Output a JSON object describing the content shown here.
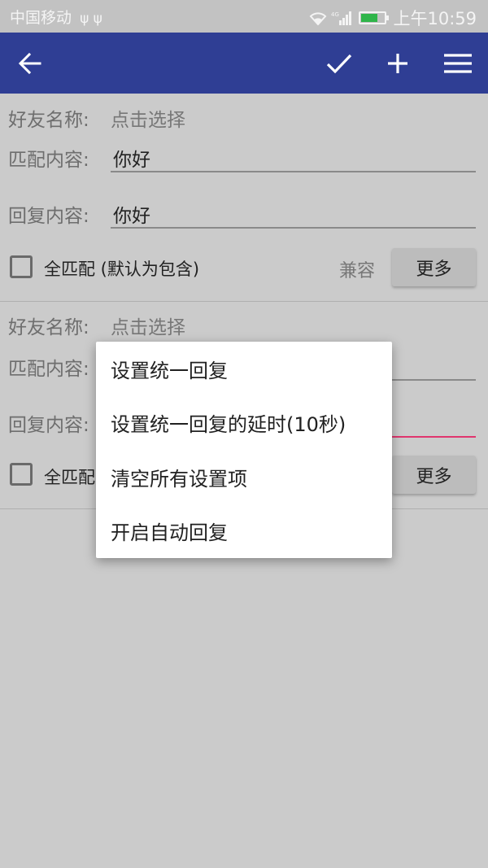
{
  "status_bar": {
    "carrier": "中国移动",
    "usb_glyphs": "ψ ψ",
    "network_type": "4G",
    "time": "上午10:59",
    "battery_level": 0.7
  },
  "toolbar": {
    "back_icon": "arrow-left-icon",
    "confirm_icon": "check-icon",
    "add_icon": "plus-icon",
    "menu_icon": "hamburger-menu-icon",
    "background_color": "#2f3e94"
  },
  "rules": [
    {
      "friend_label": "好友名称:",
      "friend_value": "点击选择",
      "match_label": "匹配内容:",
      "match_value": "你好",
      "reply_label": "回复内容:",
      "reply_value": "你好",
      "full_match_label": "全匹配 (默认为包含)",
      "compat_label": "兼容",
      "more_label": "更多"
    },
    {
      "friend_label": "好友名称:",
      "friend_value": "点击选择",
      "match_label": "匹配内容:",
      "match_value": "",
      "reply_label": "回复内容:",
      "reply_value": "",
      "full_match_label": "全匹配",
      "more_label": "更多"
    }
  ],
  "popup_menu": {
    "items": [
      "设置统一回复",
      "设置统一回复的延时(10秒)",
      "清空所有设置项",
      "开启自动回复"
    ]
  },
  "accent_color": "#e0356e"
}
